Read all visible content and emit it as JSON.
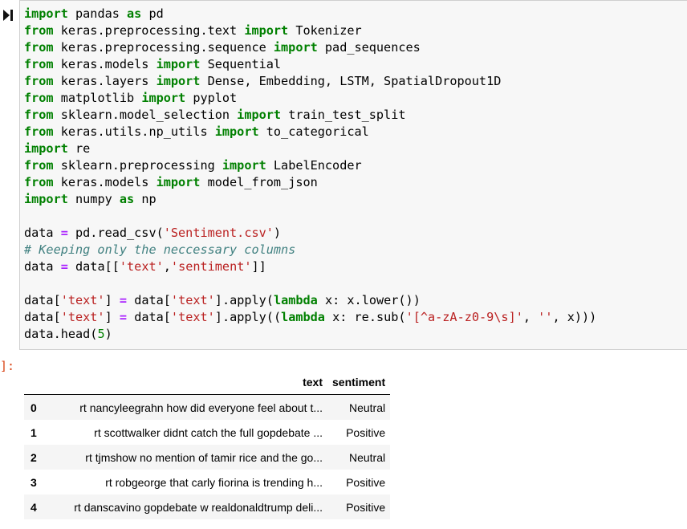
{
  "cell": {
    "code": [
      [
        {
          "t": "import",
          "c": "kw"
        },
        {
          "t": " pandas "
        },
        {
          "t": "as",
          "c": "kw"
        },
        {
          "t": " pd"
        }
      ],
      [
        {
          "t": "from",
          "c": "kw"
        },
        {
          "t": " keras.preprocessing.text "
        },
        {
          "t": "import",
          "c": "kw"
        },
        {
          "t": " Tokenizer"
        }
      ],
      [
        {
          "t": "from",
          "c": "kw"
        },
        {
          "t": " keras.preprocessing.sequence "
        },
        {
          "t": "import",
          "c": "kw"
        },
        {
          "t": " pad_sequences"
        }
      ],
      [
        {
          "t": "from",
          "c": "kw"
        },
        {
          "t": " keras.models "
        },
        {
          "t": "import",
          "c": "kw"
        },
        {
          "t": " Sequential"
        }
      ],
      [
        {
          "t": "from",
          "c": "kw"
        },
        {
          "t": " keras.layers "
        },
        {
          "t": "import",
          "c": "kw"
        },
        {
          "t": " Dense, Embedding, LSTM, SpatialDropout1D"
        }
      ],
      [
        {
          "t": "from",
          "c": "kw"
        },
        {
          "t": " matplotlib "
        },
        {
          "t": "import",
          "c": "kw"
        },
        {
          "t": " pyplot"
        }
      ],
      [
        {
          "t": "from",
          "c": "kw"
        },
        {
          "t": " sklearn.model_selection "
        },
        {
          "t": "import",
          "c": "kw"
        },
        {
          "t": " train_test_split"
        }
      ],
      [
        {
          "t": "from",
          "c": "kw"
        },
        {
          "t": " keras.utils.np_utils "
        },
        {
          "t": "import",
          "c": "kw"
        },
        {
          "t": " to_categorical"
        }
      ],
      [
        {
          "t": "import",
          "c": "kw"
        },
        {
          "t": " re"
        }
      ],
      [
        {
          "t": "from",
          "c": "kw"
        },
        {
          "t": " sklearn.preprocessing "
        },
        {
          "t": "import",
          "c": "kw"
        },
        {
          "t": " LabelEncoder"
        }
      ],
      [
        {
          "t": "from",
          "c": "kw"
        },
        {
          "t": " keras.models "
        },
        {
          "t": "import",
          "c": "kw"
        },
        {
          "t": " model_from_json"
        }
      ],
      [
        {
          "t": "import",
          "c": "kw"
        },
        {
          "t": " numpy "
        },
        {
          "t": "as",
          "c": "kw"
        },
        {
          "t": " np"
        }
      ],
      [],
      [
        {
          "t": "data "
        },
        {
          "t": "=",
          "c": "op"
        },
        {
          "t": " pd.read_csv("
        },
        {
          "t": "'Sentiment.csv'",
          "c": "str"
        },
        {
          "t": ")"
        }
      ],
      [
        {
          "t": "# Keeping only the neccessary columns",
          "c": "cm"
        }
      ],
      [
        {
          "t": "data "
        },
        {
          "t": "=",
          "c": "op"
        },
        {
          "t": " data[["
        },
        {
          "t": "'text'",
          "c": "str"
        },
        {
          "t": ","
        },
        {
          "t": "'sentiment'",
          "c": "str"
        },
        {
          "t": "]]"
        }
      ],
      [],
      [
        {
          "t": "data["
        },
        {
          "t": "'text'",
          "c": "str"
        },
        {
          "t": "] "
        },
        {
          "t": "=",
          "c": "op"
        },
        {
          "t": " data["
        },
        {
          "t": "'text'",
          "c": "str"
        },
        {
          "t": "].apply("
        },
        {
          "t": "lambda",
          "c": "kw"
        },
        {
          "t": " x: x.lower())"
        }
      ],
      [
        {
          "t": "data["
        },
        {
          "t": "'text'",
          "c": "str"
        },
        {
          "t": "] "
        },
        {
          "t": "=",
          "c": "op"
        },
        {
          "t": " data["
        },
        {
          "t": "'text'",
          "c": "str"
        },
        {
          "t": "].apply(("
        },
        {
          "t": "lambda",
          "c": "kw"
        },
        {
          "t": " x: re.sub("
        },
        {
          "t": "'[^a-zA-z0-9\\s]'",
          "c": "str"
        },
        {
          "t": ", "
        },
        {
          "t": "''",
          "c": "str"
        },
        {
          "t": ", x)))"
        }
      ],
      [
        {
          "t": "data.head("
        },
        {
          "t": "5",
          "c": "num"
        },
        {
          "t": ")"
        }
      ]
    ]
  },
  "output": {
    "prompt": "]:",
    "table": {
      "columns": [
        "text",
        "sentiment"
      ],
      "rows": [
        {
          "index": "0",
          "text": "rt nancyleegrahn how did everyone feel about t...",
          "sentiment": "Neutral"
        },
        {
          "index": "1",
          "text": "rt scottwalker didnt catch the full gopdebate ...",
          "sentiment": "Positive"
        },
        {
          "index": "2",
          "text": "rt tjmshow no mention of tamir rice and the go...",
          "sentiment": "Neutral"
        },
        {
          "index": "3",
          "text": "rt robgeorge that carly fiorina is trending h...",
          "sentiment": "Positive"
        },
        {
          "index": "4",
          "text": "rt danscavino gopdebate w realdonaldtrump deli...",
          "sentiment": "Positive"
        }
      ]
    }
  },
  "icons": {
    "run": "run-cell-icon"
  },
  "colors": {
    "keyword": "#008000",
    "string": "#ba2121",
    "comment": "#408080",
    "operator": "#aa22ff",
    "out_prompt": "#d84315",
    "cell_bg": "#f7f7f7"
  }
}
